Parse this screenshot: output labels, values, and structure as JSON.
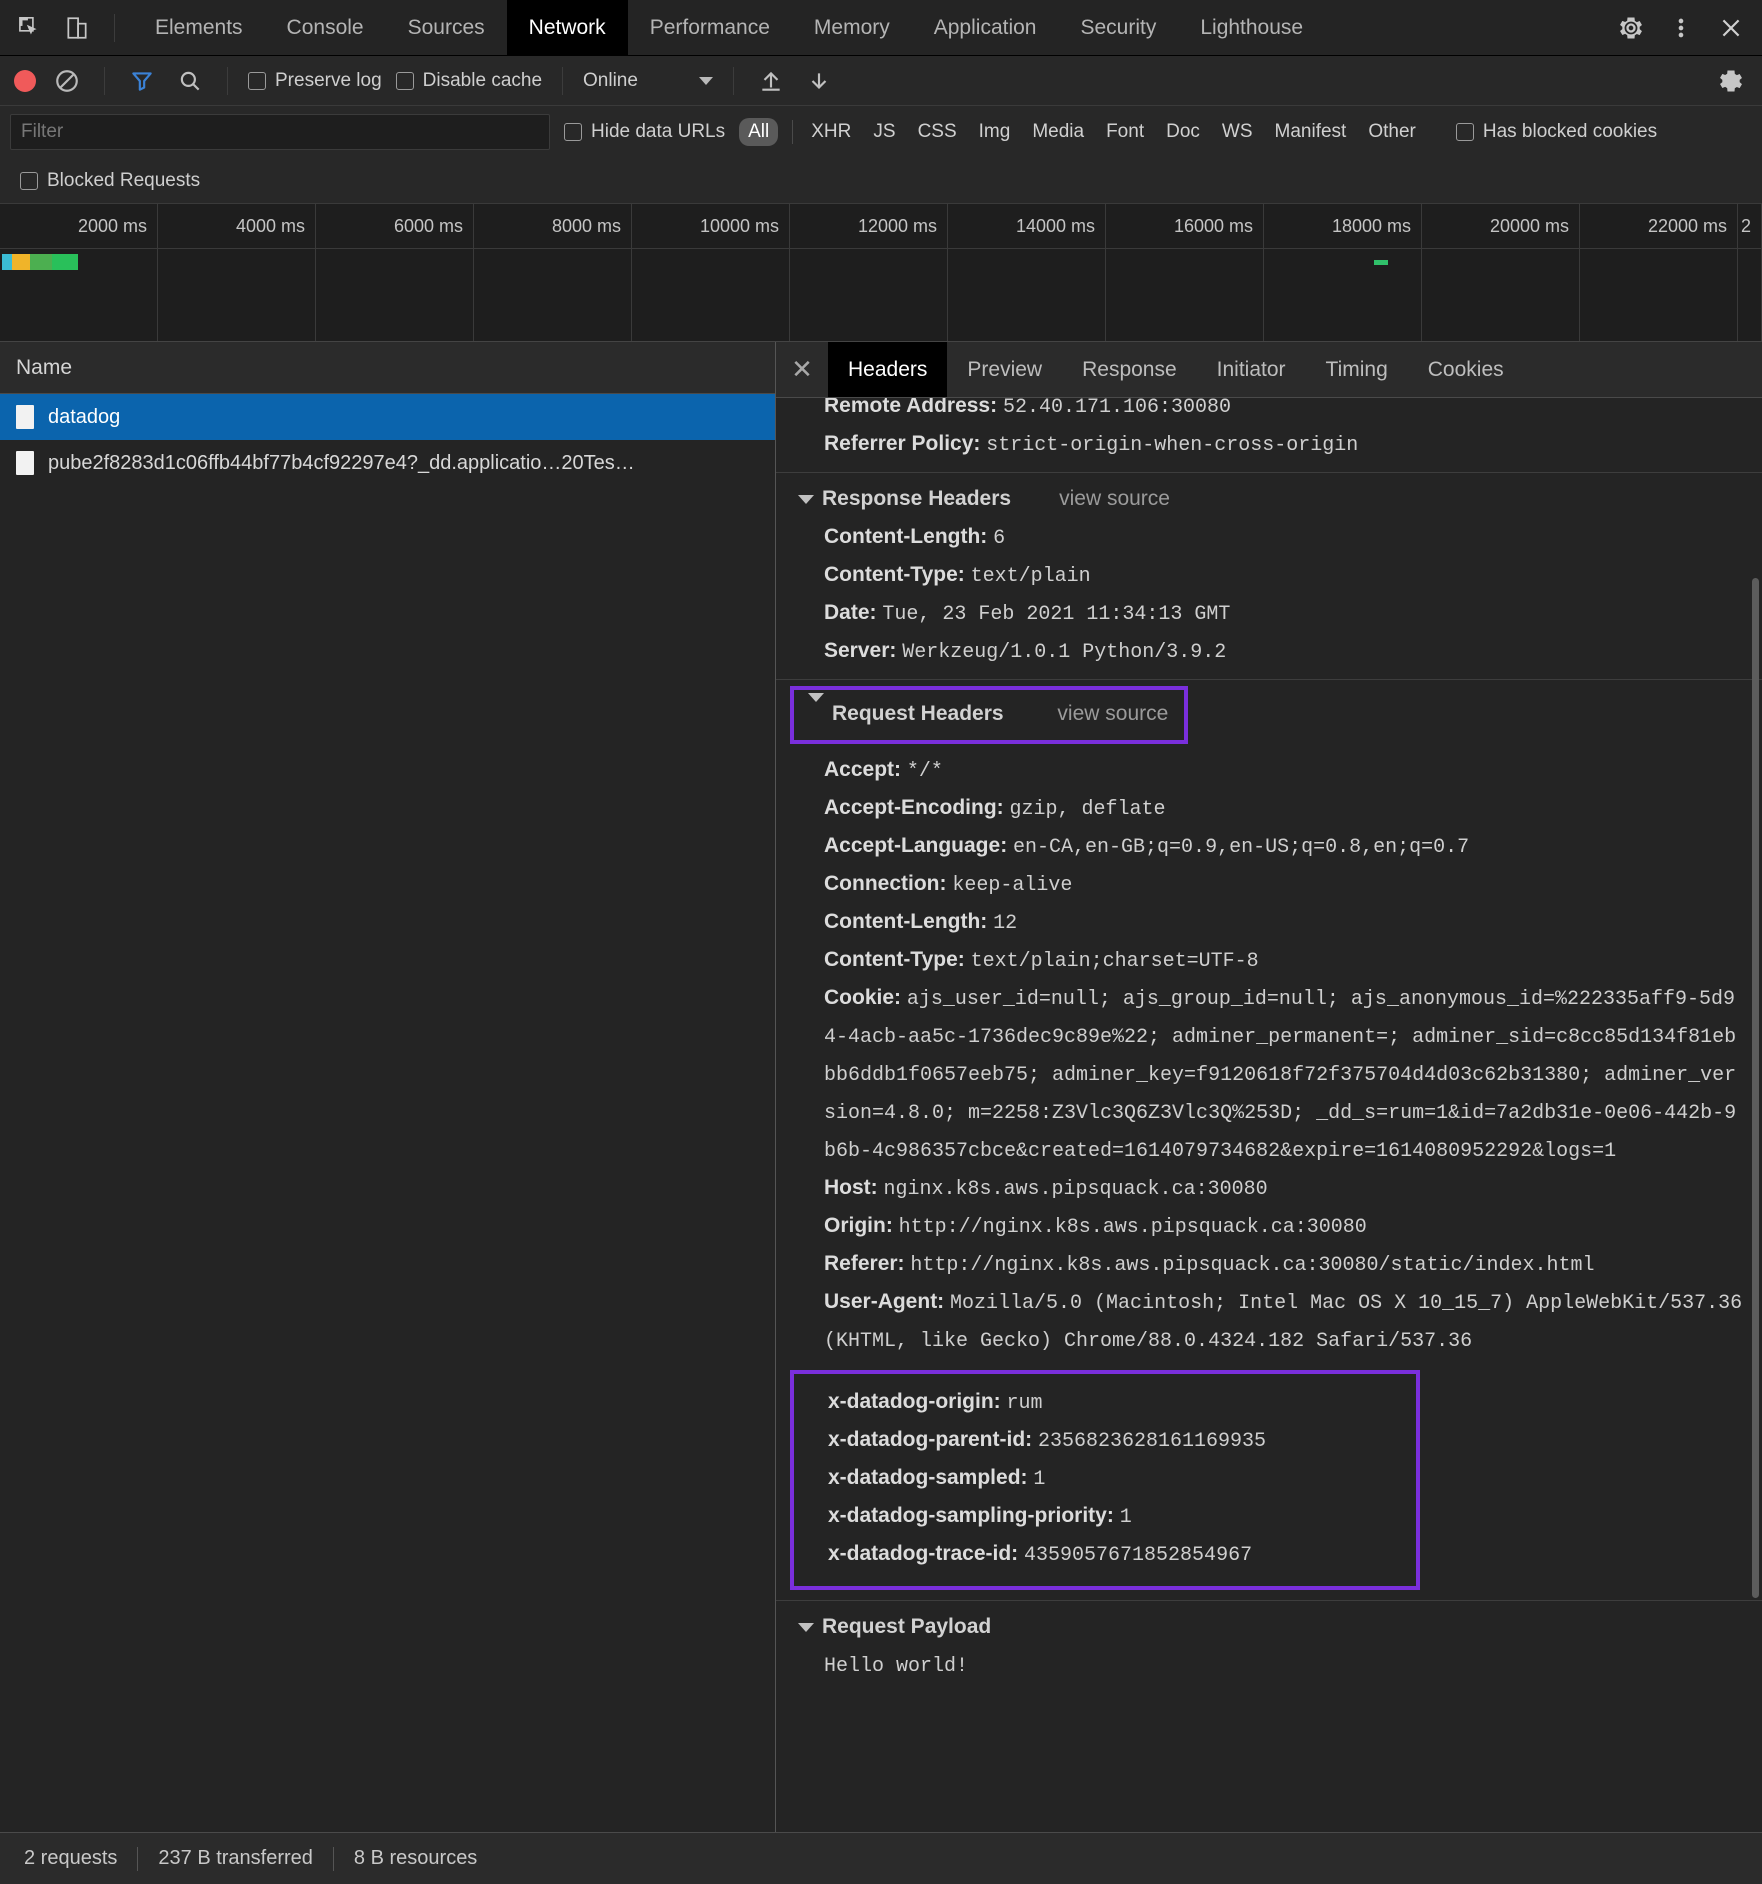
{
  "window": {
    "panel_tabs": [
      {
        "label": "Elements",
        "active": false
      },
      {
        "label": "Console",
        "active": false
      },
      {
        "label": "Sources",
        "active": false
      },
      {
        "label": "Network",
        "active": true
      },
      {
        "label": "Performance",
        "active": false
      },
      {
        "label": "Memory",
        "active": false
      },
      {
        "label": "Application",
        "active": false
      },
      {
        "label": "Security",
        "active": false
      },
      {
        "label": "Lighthouse",
        "active": false
      }
    ]
  },
  "toolbar": {
    "preserve_log_label": "Preserve log",
    "disable_cache_label": "Disable cache",
    "throttle_value": "Online"
  },
  "filterbar": {
    "filter_placeholder": "Filter",
    "filter_value": "",
    "hide_data_urls_label": "Hide data URLs",
    "types": [
      "All",
      "XHR",
      "JS",
      "CSS",
      "Img",
      "Media",
      "Font",
      "Doc",
      "WS",
      "Manifest",
      "Other"
    ],
    "selected_type": "All",
    "has_blocked_cookies_label": "Has blocked cookies",
    "blocked_requests_label": "Blocked Requests"
  },
  "overview": {
    "ticks": [
      "2000 ms",
      "4000 ms",
      "6000 ms",
      "8000 ms",
      "10000 ms",
      "12000 ms",
      "14000 ms",
      "16000 ms",
      "18000 ms",
      "20000 ms",
      "22000 ms",
      "2"
    ],
    "bar_colors": [
      "#3bbcd4",
      "#f0b429",
      "#4caf50",
      "#29c05a"
    ],
    "marker_color": "#30c06a"
  },
  "requests": {
    "column_header": "Name",
    "rows": [
      {
        "name": "datadog",
        "selected": true
      },
      {
        "name": "pube2f8283d1c06ffb44bf77b4cf92297e4?_dd.applicatio…20Tes…",
        "selected": false
      }
    ]
  },
  "detail": {
    "tabs": [
      {
        "label": "Headers",
        "active": true
      },
      {
        "label": "Preview",
        "active": false
      },
      {
        "label": "Response",
        "active": false
      },
      {
        "label": "Initiator",
        "active": false
      },
      {
        "label": "Timing",
        "active": false
      },
      {
        "label": "Cookies",
        "active": false
      }
    ],
    "general_partial": [
      {
        "name": "Remote Address:",
        "value": "52.40.171.106:30080"
      },
      {
        "name": "Referrer Policy:",
        "value": "strict-origin-when-cross-origin"
      }
    ],
    "response_headers": {
      "title": "Response Headers",
      "view_source": "view source",
      "items": [
        {
          "name": "Content-Length:",
          "value": "6"
        },
        {
          "name": "Content-Type:",
          "value": "text/plain"
        },
        {
          "name": "Date:",
          "value": "Tue, 23 Feb 2021 11:34:13 GMT"
        },
        {
          "name": "Server:",
          "value": "Werkzeug/1.0.1 Python/3.9.2"
        }
      ]
    },
    "request_headers": {
      "title": "Request Headers",
      "view_source": "view source",
      "highlighted": true,
      "items": [
        {
          "name": "Accept:",
          "value": "*/*"
        },
        {
          "name": "Accept-Encoding:",
          "value": "gzip, deflate"
        },
        {
          "name": "Accept-Language:",
          "value": "en-CA,en-GB;q=0.9,en-US;q=0.8,en;q=0.7"
        },
        {
          "name": "Connection:",
          "value": "keep-alive"
        },
        {
          "name": "Content-Length:",
          "value": "12"
        },
        {
          "name": "Content-Type:",
          "value": "text/plain;charset=UTF-8"
        },
        {
          "name": "Cookie:",
          "value": "ajs_user_id=null; ajs_group_id=null; ajs_anonymous_id=%222335aff9-5d94-4acb-aa5c-1736dec9c89e%22; adminer_permanent=; adminer_sid=c8cc85d134f81ebbb6ddb1f0657eeb75; adminer_key=f9120618f72f375704d4d03c62b31380; adminer_version=4.8.0; m=2258:Z3Vlc3Q6Z3Vlc3Q%253D; _dd_s=rum=1&id=7a2db31e-0e06-442b-9b6b-4c986357cbce&created=1614079734682&expire=1614080952292&logs=1"
        },
        {
          "name": "Host:",
          "value": "nginx.k8s.aws.pipsquack.ca:30080"
        },
        {
          "name": "Origin:",
          "value": "http://nginx.k8s.aws.pipsquack.ca:30080"
        },
        {
          "name": "Referer:",
          "value": "http://nginx.k8s.aws.pipsquack.ca:30080/static/index.html"
        },
        {
          "name": "User-Agent:",
          "value": "Mozilla/5.0 (Macintosh; Intel Mac OS X 10_15_7) AppleWebKit/537.36 (KHTML, like Gecko) Chrome/88.0.4324.182 Safari/537.36"
        }
      ],
      "highlighted_items": [
        {
          "name": "x-datadog-origin:",
          "value": "rum"
        },
        {
          "name": "x-datadog-parent-id:",
          "value": "2356823628161169935"
        },
        {
          "name": "x-datadog-sampled:",
          "value": "1"
        },
        {
          "name": "x-datadog-sampling-priority:",
          "value": "1"
        },
        {
          "name": "x-datadog-trace-id:",
          "value": "4359057671852854967"
        }
      ]
    },
    "request_payload": {
      "title": "Request Payload",
      "body": "Hello world!"
    }
  },
  "statusbar": {
    "requests": "2 requests",
    "transferred": "237 B transferred",
    "resources": "8 B resources"
  },
  "colors": {
    "highlight": "#7a2fdc",
    "selection": "#0b64ad",
    "record": "#f05a5a",
    "filter_active": "#3b82d6"
  }
}
